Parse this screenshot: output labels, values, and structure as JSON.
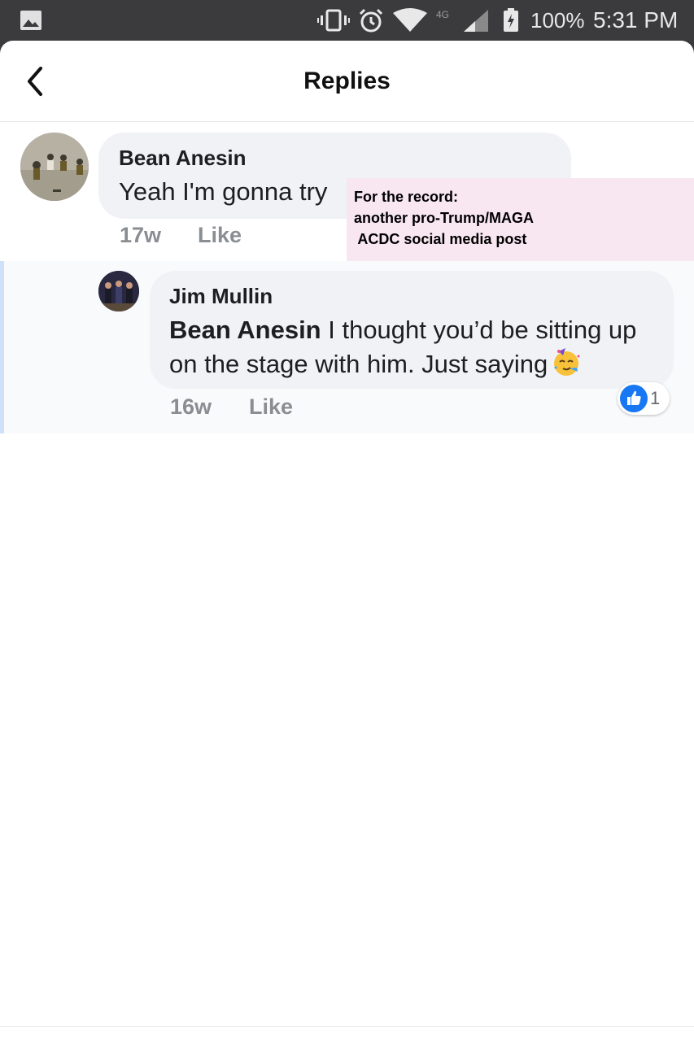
{
  "status_bar": {
    "battery": "100%",
    "time": "5:31 PM",
    "icons": [
      "gallery-icon",
      "vibrate-icon",
      "alarm-icon",
      "wifi-icon",
      "lte-4g-icon",
      "signal-icon",
      "battery-icon"
    ]
  },
  "header": {
    "title": "Replies",
    "back_icon": "chevron-left-icon"
  },
  "comments": [
    {
      "author": "Bean Anesin",
      "text": "Yeah I'm gonna try",
      "time": "17w",
      "like_label": "Like"
    }
  ],
  "replies": [
    {
      "author": "Jim Mullin",
      "mention": "Bean Anesin",
      "text": " I thought you’d be sitting up on the stage with him. Just saying",
      "emoji": "partying-face-emoji",
      "time": "16w",
      "like_label": "Like",
      "reaction_count": "1"
    }
  ],
  "annotation": {
    "line1": "For the record:",
    "line2": "another pro-Trump/MAGA",
    "line3": " ACDC social media post",
    "background": "#f8e6f1"
  },
  "colors": {
    "bubble": "#f0f2f5",
    "like_blue": "#1877f2",
    "meta_gray": "#8a8d91",
    "reply_bar": "#cfe0fb"
  }
}
